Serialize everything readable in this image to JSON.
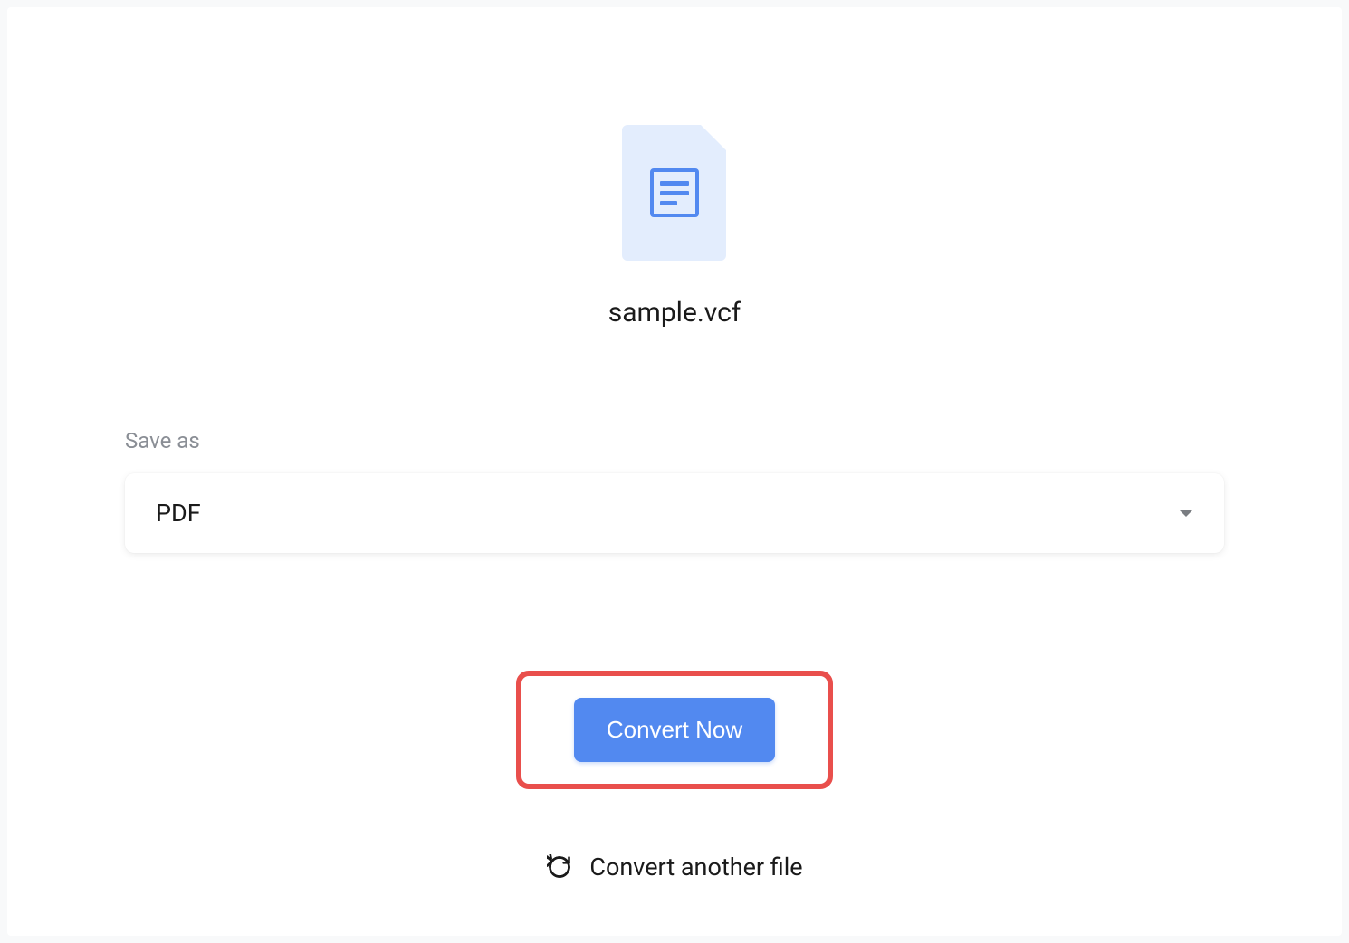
{
  "file": {
    "name": "sample.vcf"
  },
  "saveAs": {
    "label": "Save as",
    "selected": "PDF"
  },
  "actions": {
    "convertNow": "Convert Now",
    "convertAnother": "Convert another file"
  }
}
